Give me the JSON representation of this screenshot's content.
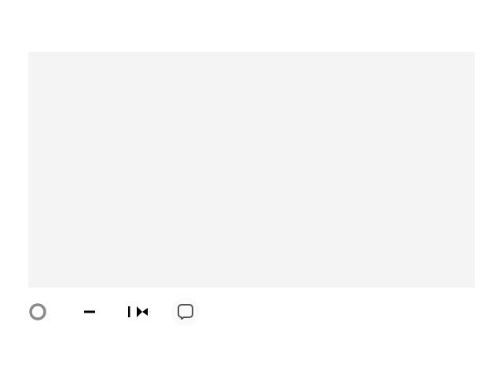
{
  "content_area": {
    "background": "#f4f4f4"
  },
  "toolbar": {
    "buttons": [
      {
        "name": "record",
        "icon": "circle-icon",
        "color": "#8a8a8a"
      },
      {
        "name": "minimize",
        "icon": "minus-icon",
        "color": "#000000"
      },
      {
        "name": "skip",
        "icon": "skip-forward-icon",
        "color": "#000000"
      },
      {
        "name": "chat",
        "icon": "chat-bubble-icon",
        "color": "#555555"
      }
    ]
  }
}
